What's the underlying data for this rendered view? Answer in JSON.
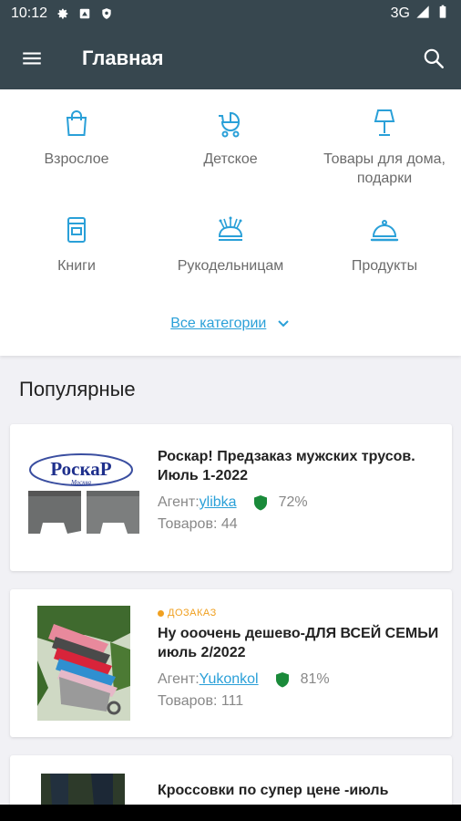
{
  "status_bar": {
    "time": "10:12",
    "network": "3G",
    "icons": [
      "settings-icon",
      "notification-icon",
      "shield-icon",
      "signal-icon",
      "battery-icon"
    ]
  },
  "app_bar": {
    "title": "Главная",
    "icons": [
      "menu-icon",
      "search-icon"
    ]
  },
  "categories": {
    "items": [
      {
        "label": "Взрослое",
        "icon": "shopping-bag-icon"
      },
      {
        "label": "Детское",
        "icon": "stroller-icon"
      },
      {
        "label": "Товары для дома, подарки",
        "icon": "lamp-icon"
      },
      {
        "label": "Книги",
        "icon": "book-icon"
      },
      {
        "label": "Рукодельницам",
        "icon": "pincushion-icon"
      },
      {
        "label": "Продукты",
        "icon": "cloche-icon"
      }
    ],
    "all_label": "Все категории"
  },
  "popular": {
    "title": "Популярные",
    "agent_prefix": "Агент:",
    "count_prefix": "Товаров: ",
    "items": [
      {
        "title": "Роскар! Предзаказ мужских трусов. Июль 1-2022",
        "agent": "ylibka",
        "rating": "72%",
        "count": "44",
        "badge": "",
        "logo_text": "РоскаР",
        "logo_subtext": "Москва"
      },
      {
        "title": "Ну ооочень дешево-ДЛЯ ВСЕЙ СЕМЬИ июль 2/2022",
        "agent": "Yukonkol",
        "rating": "81%",
        "count": "111",
        "badge": "ДОЗАКАЗ"
      },
      {
        "title": "Кроссовки по супер цене -июль"
      }
    ]
  },
  "colors": {
    "app_bar": "#37474f",
    "accent": "#2aa0d8",
    "badge": "#f0a020",
    "shield": "#1a8a3a"
  }
}
